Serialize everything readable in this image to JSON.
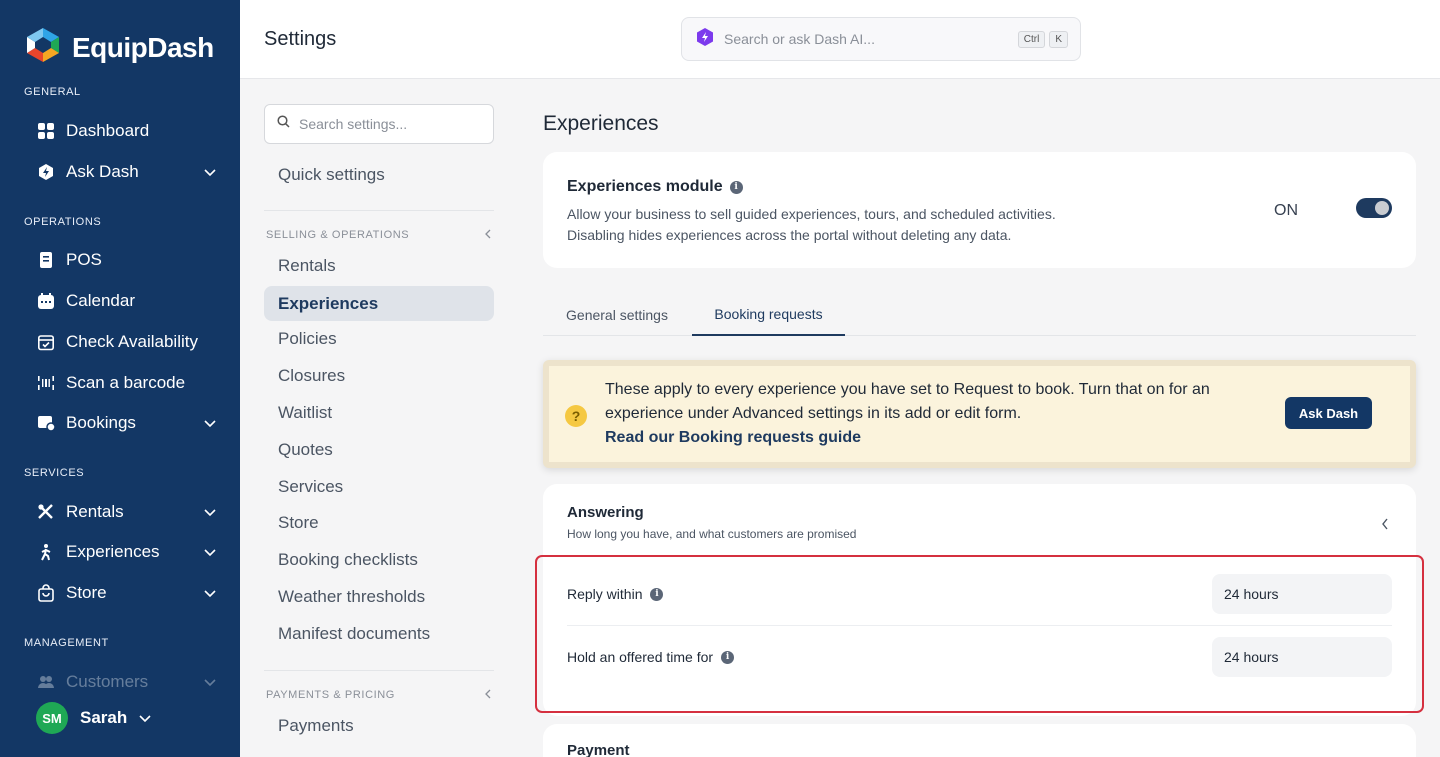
{
  "app": {
    "name": "EquipDash"
  },
  "sidebar": {
    "sections": {
      "general": "GENERAL",
      "operations": "OPERATIONS",
      "services": "SERVICES",
      "management": "MANAGEMENT"
    },
    "items": [
      {
        "label": "Dashboard",
        "icon": "grid-icon"
      },
      {
        "label": "Ask Dash",
        "icon": "ai-shield-icon"
      },
      {
        "label": "POS",
        "icon": "receipt-icon"
      },
      {
        "label": "Calendar",
        "icon": "calendar-icon"
      },
      {
        "label": "Check Availability",
        "icon": "calendar-check-icon"
      },
      {
        "label": "Scan a barcode",
        "icon": "barcode-icon"
      },
      {
        "label": "Bookings",
        "icon": "bookings-icon"
      },
      {
        "label": "Rentals",
        "icon": "tools-icon"
      },
      {
        "label": "Experiences",
        "icon": "person-hiking-icon"
      },
      {
        "label": "Store",
        "icon": "shopping-bag-icon"
      },
      {
        "label": "Customers",
        "icon": "users-icon"
      }
    ],
    "user": {
      "initials": "SM",
      "name": "Sarah"
    }
  },
  "header": {
    "title": "Settings",
    "search_placeholder": "Search or ask Dash AI...",
    "shortcut": [
      "Ctrl",
      "K"
    ]
  },
  "settings_nav": {
    "search_placeholder": "Search settings...",
    "quick": "Quick settings",
    "group1": "SELLING & OPERATIONS",
    "items": [
      "Rentals",
      "Experiences",
      "Policies",
      "Closures",
      "Waitlist",
      "Quotes",
      "Services",
      "Store",
      "Booking checklists",
      "Weather thresholds",
      "Manifest documents"
    ],
    "group2": "PAYMENTS & PRICING",
    "items2": [
      "Payments"
    ]
  },
  "main": {
    "title": "Experiences",
    "module": {
      "title": "Experiences module",
      "desc1": "Allow your business to sell guided experiences, tours, and scheduled activities.",
      "desc2": "Disabling hides experiences across the portal without deleting any data.",
      "state": "ON"
    },
    "tabs": [
      "General settings",
      "Booking requests"
    ],
    "notice": {
      "t1": "These apply to every experience you have set to ",
      "t2": "Request to book",
      "t3": ". Turn that on for an experience under ",
      "t4": "Advanced settings",
      "t5": " in its add or edit form.",
      "link": "Read our Booking requests guide",
      "button": "Ask Dash"
    },
    "answering": {
      "title": "Answering",
      "subtitle": "How long you have, and what customers are promised",
      "rows": [
        {
          "label": "Reply within",
          "value": "24 hours"
        },
        {
          "label": "Hold an offered time for",
          "value": "24 hours"
        }
      ]
    },
    "payment": {
      "title": "Payment"
    }
  },
  "colors": {
    "sidebar": "#133765",
    "accent": "#1e3a5f",
    "highlight": "#d5303f",
    "notice": "#fbf3dc"
  }
}
